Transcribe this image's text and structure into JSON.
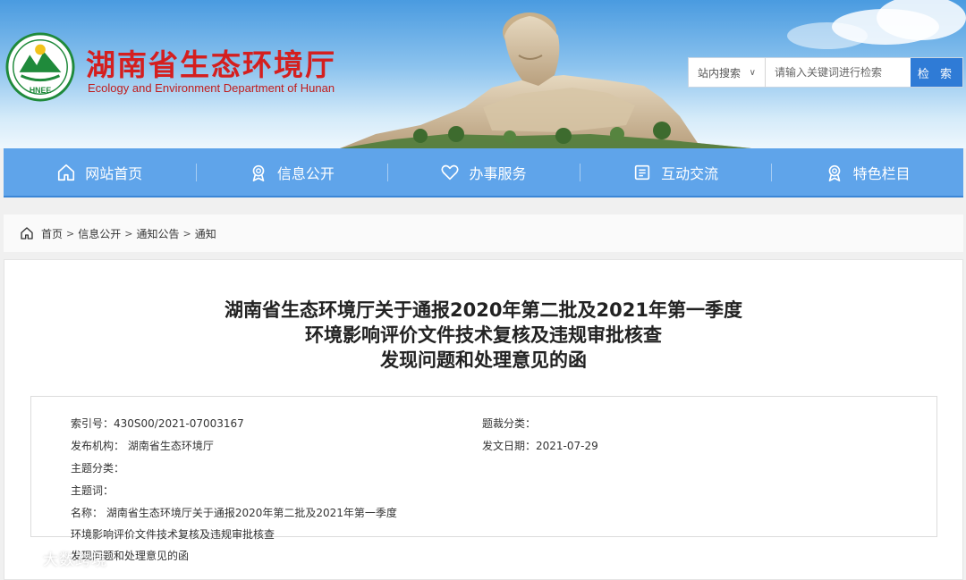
{
  "header": {
    "title": "湖南省生态环境厅",
    "subtitle": "Ecology and Environment Department of Hunan",
    "logo_text": "HNEE"
  },
  "search": {
    "scope": "站内搜索",
    "placeholder": "请输入关键词进行检索",
    "button": "检 索"
  },
  "nav": {
    "items": [
      {
        "label": "网站首页",
        "icon": "home-icon"
      },
      {
        "label": "信息公开",
        "icon": "badge-icon"
      },
      {
        "label": "办事服务",
        "icon": "heart-icon"
      },
      {
        "label": "互动交流",
        "icon": "document-icon"
      },
      {
        "label": "特色栏目",
        "icon": "badge-icon"
      }
    ]
  },
  "breadcrumb": {
    "items": [
      "首页",
      "信息公开",
      "通知公告",
      "通知"
    ],
    "separator": ">"
  },
  "article": {
    "title_lines": [
      "湖南省生态环境厅关于通报2020年第二批及2021年第一季度",
      "环境影响评价文件技术复核及违规审批核查",
      "发现问题和处理意见的函"
    ],
    "meta": {
      "index": "索引号：430S00/2021-07003167",
      "category": "题裁分类：",
      "publisher": "发布机构：  湖南省生态环境厅",
      "date": "发文日期：2021-07-29",
      "topic": "主题分类：",
      "keywords": "主题词：",
      "name_line1": "名称：  湖南省生态环境厅关于通报2020年第二批及2021年第一季度",
      "name_line2": "环境影响评价文件技术复核及违规审批核查",
      "name_line3": "发现问题和处理意见的函"
    }
  },
  "watermark": "大数跨境",
  "colors": {
    "brand_red": "#d41f1f",
    "nav_blue": "#5fa4ea",
    "button_blue": "#2f7bd6"
  }
}
